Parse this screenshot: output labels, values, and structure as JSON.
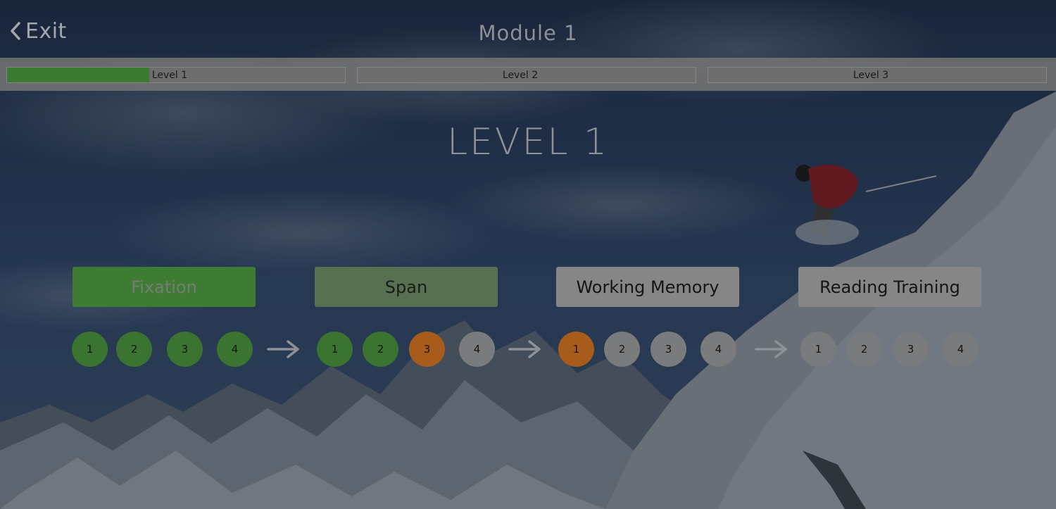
{
  "header": {
    "exit_label": "Exit",
    "title": "Module 1"
  },
  "progress": [
    {
      "label": "Level 1",
      "complete_fraction": 0.42
    },
    {
      "label": "Level 2",
      "complete_fraction": 0
    },
    {
      "label": "Level 3",
      "complete_fraction": 0
    }
  ],
  "level_title": "LEVEL 1",
  "stages": [
    {
      "label": "Fixation",
      "steps": [
        {
          "number": "1",
          "status": "done"
        },
        {
          "number": "2",
          "status": "done"
        },
        {
          "number": "3",
          "status": "done"
        },
        {
          "number": "4",
          "status": "done"
        }
      ]
    },
    {
      "label": "Span",
      "steps": [
        {
          "number": "1",
          "status": "done"
        },
        {
          "number": "2",
          "status": "done"
        },
        {
          "number": "3",
          "status": "current"
        },
        {
          "number": "4",
          "status": "todo"
        }
      ]
    },
    {
      "label": "Working Memory",
      "steps": [
        {
          "number": "1",
          "status": "current"
        },
        {
          "number": "2",
          "status": "todo"
        },
        {
          "number": "3",
          "status": "todo"
        },
        {
          "number": "4",
          "status": "todo"
        }
      ]
    },
    {
      "label": "Reading Training",
      "steps": [
        {
          "number": "1",
          "status": "todo"
        },
        {
          "number": "2",
          "status": "todo"
        },
        {
          "number": "3",
          "status": "todo"
        },
        {
          "number": "4",
          "status": "todo"
        }
      ]
    }
  ],
  "icons": {
    "exit": "chevron-left-icon",
    "connector": "arrow-right-icon"
  },
  "colors": {
    "done": "#3a7430",
    "current": "#a85c1c",
    "todo": "#7a7b7d",
    "progress_fill": "#3b7a32"
  }
}
